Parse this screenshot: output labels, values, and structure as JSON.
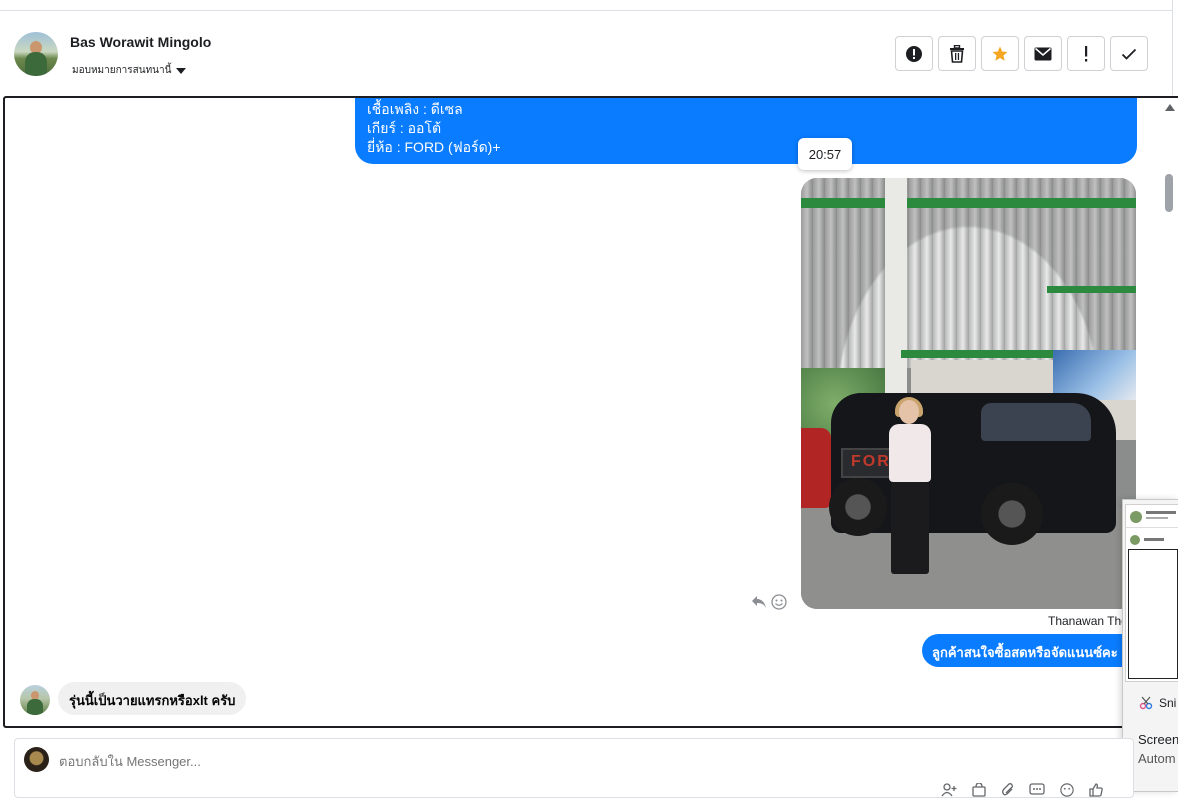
{
  "header": {
    "name": "Bas Worawit Mingolo",
    "assign_label": "มอบหมายการสนทนานี้",
    "actions": [
      {
        "icon": "alert-circle-icon",
        "label": "report"
      },
      {
        "icon": "trash-icon",
        "label": "delete"
      },
      {
        "icon": "star-icon",
        "label": "star"
      },
      {
        "icon": "mail-icon",
        "label": "mark unread"
      },
      {
        "icon": "exclamation-icon",
        "label": "follow up"
      },
      {
        "icon": "check-icon",
        "label": "done"
      }
    ],
    "star_color": "#f5a623"
  },
  "chat": {
    "message1_lines": [
      "เชื้อเพลิง : ดีเซล",
      "เกียร์ : ออโต้",
      "ยี่ห้อ : FORD (ฟอร์ด)+"
    ],
    "timestamp": "20:57",
    "sender_name": "Thanawan Tho",
    "message2": "ลูกค้าสนใจซื้อสดหรือจัดแนนซ์คะ",
    "incoming_message": "รุ่นนี้เป็นวายแทรกหรือxlt ครับ",
    "bubble_color": "#0a7cff"
  },
  "overlay": {
    "snip_label": "Sni",
    "text1": "Screen",
    "text2": "Autom"
  },
  "composer": {
    "placeholder": "ตอบกลับใน Messenger..."
  }
}
